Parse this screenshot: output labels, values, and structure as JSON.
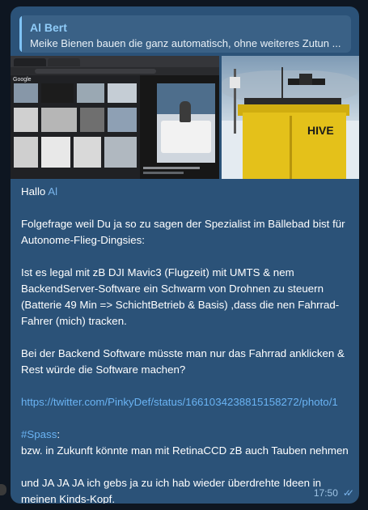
{
  "reply": {
    "author": "Al Bert",
    "text": "Meike Bienen bauen die ganz automatisch, ohne weiteres Zutun ..."
  },
  "images": {
    "left": {
      "icon": "google-images-screenshot",
      "title": "Google"
    },
    "right": {
      "icon": "hive-drone-station-photo",
      "brand": "HIVE"
    }
  },
  "message": {
    "greeting": "Hallo ",
    "mention": "Al",
    "p1": "Folgefrage weil Du ja so zu sagen der Spezialist im Bällebad bist für Autonome-Flieg-Dingsies:",
    "p2": "Ist es legal mit zB DJI Mavic3 (Flugzeit) mit UMTS & nem BackendServer-Software ein Schwarm von Drohnen zu steuern (Batterie 49 Min => SchichtBetrieb & Basis) ,dass die nen Fahrrad-Fahrer (mich) tracken.",
    "p3": "Bei der Backend Software müsste man nur das Fahrrad anklicken & Rest würde die Software machen?",
    "link": "https://twitter.com/PinkyDef/status/1661034238815158272/photo/1",
    "hashtag": "#Spass",
    "hashtag_suffix": ":",
    "p4": "bzw. in Zukunft könnte man mit RetinaCCD zB auch Tauben nehmen",
    "p5": "und JA JA JA ich gebs ja zu ich hab wieder überdrehte Ideen in meinen Kinds-Kopf."
  },
  "meta": {
    "time": "17:50",
    "status_icon": "double-check-icon",
    "checks_glyph": "✓✓"
  },
  "colors": {
    "bubble": "#2b5278",
    "background": "#0e1621",
    "link": "#6ab3f3"
  }
}
